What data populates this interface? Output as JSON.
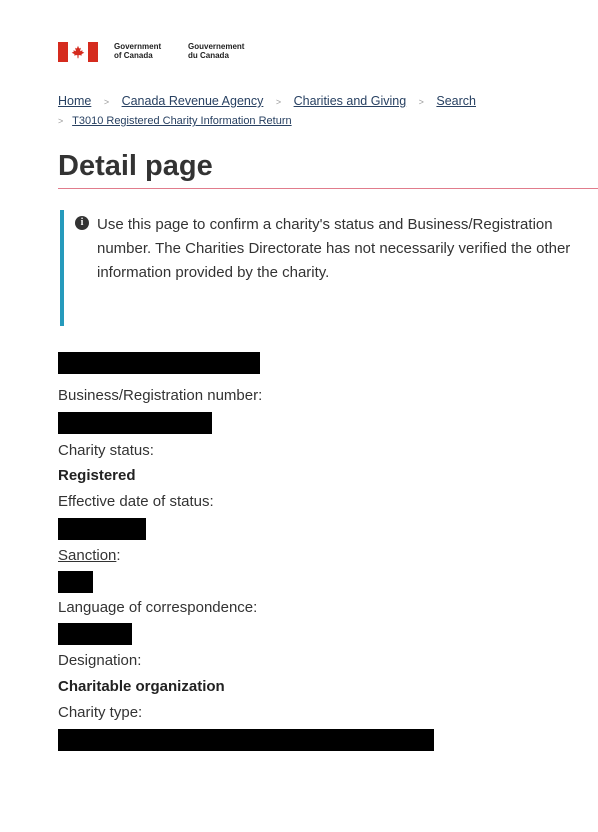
{
  "header": {
    "gov_en_line1": "Government",
    "gov_en_line2": "of Canada",
    "gov_fr_line1": "Gouvernement",
    "gov_fr_line2": "du Canada",
    "flag_icon": "canada-flag-icon"
  },
  "breadcrumb": {
    "items": [
      "Home",
      "Canada Revenue Agency",
      "Charities and Giving",
      "Search",
      "T3010 Registered Charity Information Return"
    ],
    "separator": ">"
  },
  "page_title": "Detail page",
  "notice": {
    "icon": "info-icon",
    "text": "Use this page to confirm a charity's status and Business/Registration number. The Charities Directorate has not necessarily verified the other information provided by the charity."
  },
  "fields": {
    "business_number_label": "Business/Registration number:",
    "charity_status_label": "Charity status:",
    "charity_status_value": "Registered",
    "effective_date_label": "Effective date of status:",
    "sanction_link": "Sanction",
    "sanction_suffix": ":",
    "language_label": "Language of correspondence:",
    "designation_label": "Designation:",
    "designation_value": "Charitable organization",
    "charity_type_label": "Charity type:"
  },
  "colors": {
    "flag_red": "#d52b1e",
    "link": "#284162",
    "info_border": "#269abc",
    "title_rule": "#c8102e"
  }
}
